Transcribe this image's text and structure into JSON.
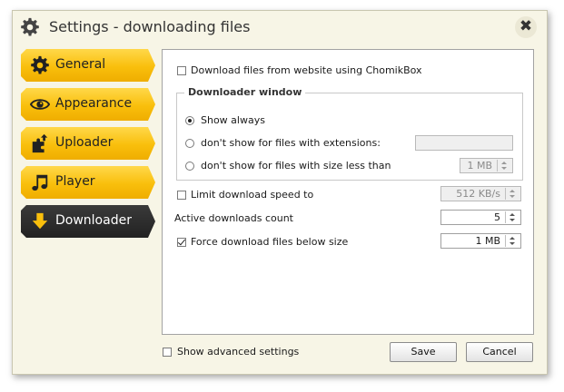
{
  "window": {
    "title": "Settings - downloading files",
    "icon": "gear-icon",
    "close_glyph": "✖"
  },
  "sidebar": {
    "items": [
      {
        "label": "General",
        "icon": "gear-icon",
        "active": false
      },
      {
        "label": "Appearance",
        "icon": "eye-icon",
        "active": false
      },
      {
        "label": "Uploader",
        "icon": "upload-puzzle-icon",
        "active": false
      },
      {
        "label": "Player",
        "icon": "music-note-icon",
        "active": false
      },
      {
        "label": "Downloader",
        "icon": "download-arrow-icon",
        "active": true
      }
    ]
  },
  "downloader": {
    "download_from_website": {
      "label": "Download files from website using ChomikBox",
      "checked": false
    },
    "window_group": {
      "title": "Downloader window",
      "options": [
        {
          "label": "Show always",
          "selected": true
        },
        {
          "label": "don't show for files with extensions:",
          "selected": false,
          "value": ""
        },
        {
          "label": "don't show for files with size less than",
          "selected": false,
          "value": "1 MB"
        }
      ]
    },
    "limit_speed": {
      "label": "Limit download speed to",
      "checked": false,
      "value": "512 KB/s"
    },
    "active_count": {
      "label": "Active downloads count",
      "value": "5"
    },
    "force_below": {
      "label": "Force download files below size",
      "checked": true,
      "value": "1 MB"
    }
  },
  "footer": {
    "show_advanced": {
      "label": "Show advanced settings",
      "checked": false
    },
    "save_label": "Save",
    "cancel_label": "Cancel"
  },
  "colors": {
    "accent_yellow": "#f9bf0c",
    "active_dark": "#2b2b2b",
    "window_bg": "#f7f5e6",
    "panel_bg": "#ffffff"
  }
}
